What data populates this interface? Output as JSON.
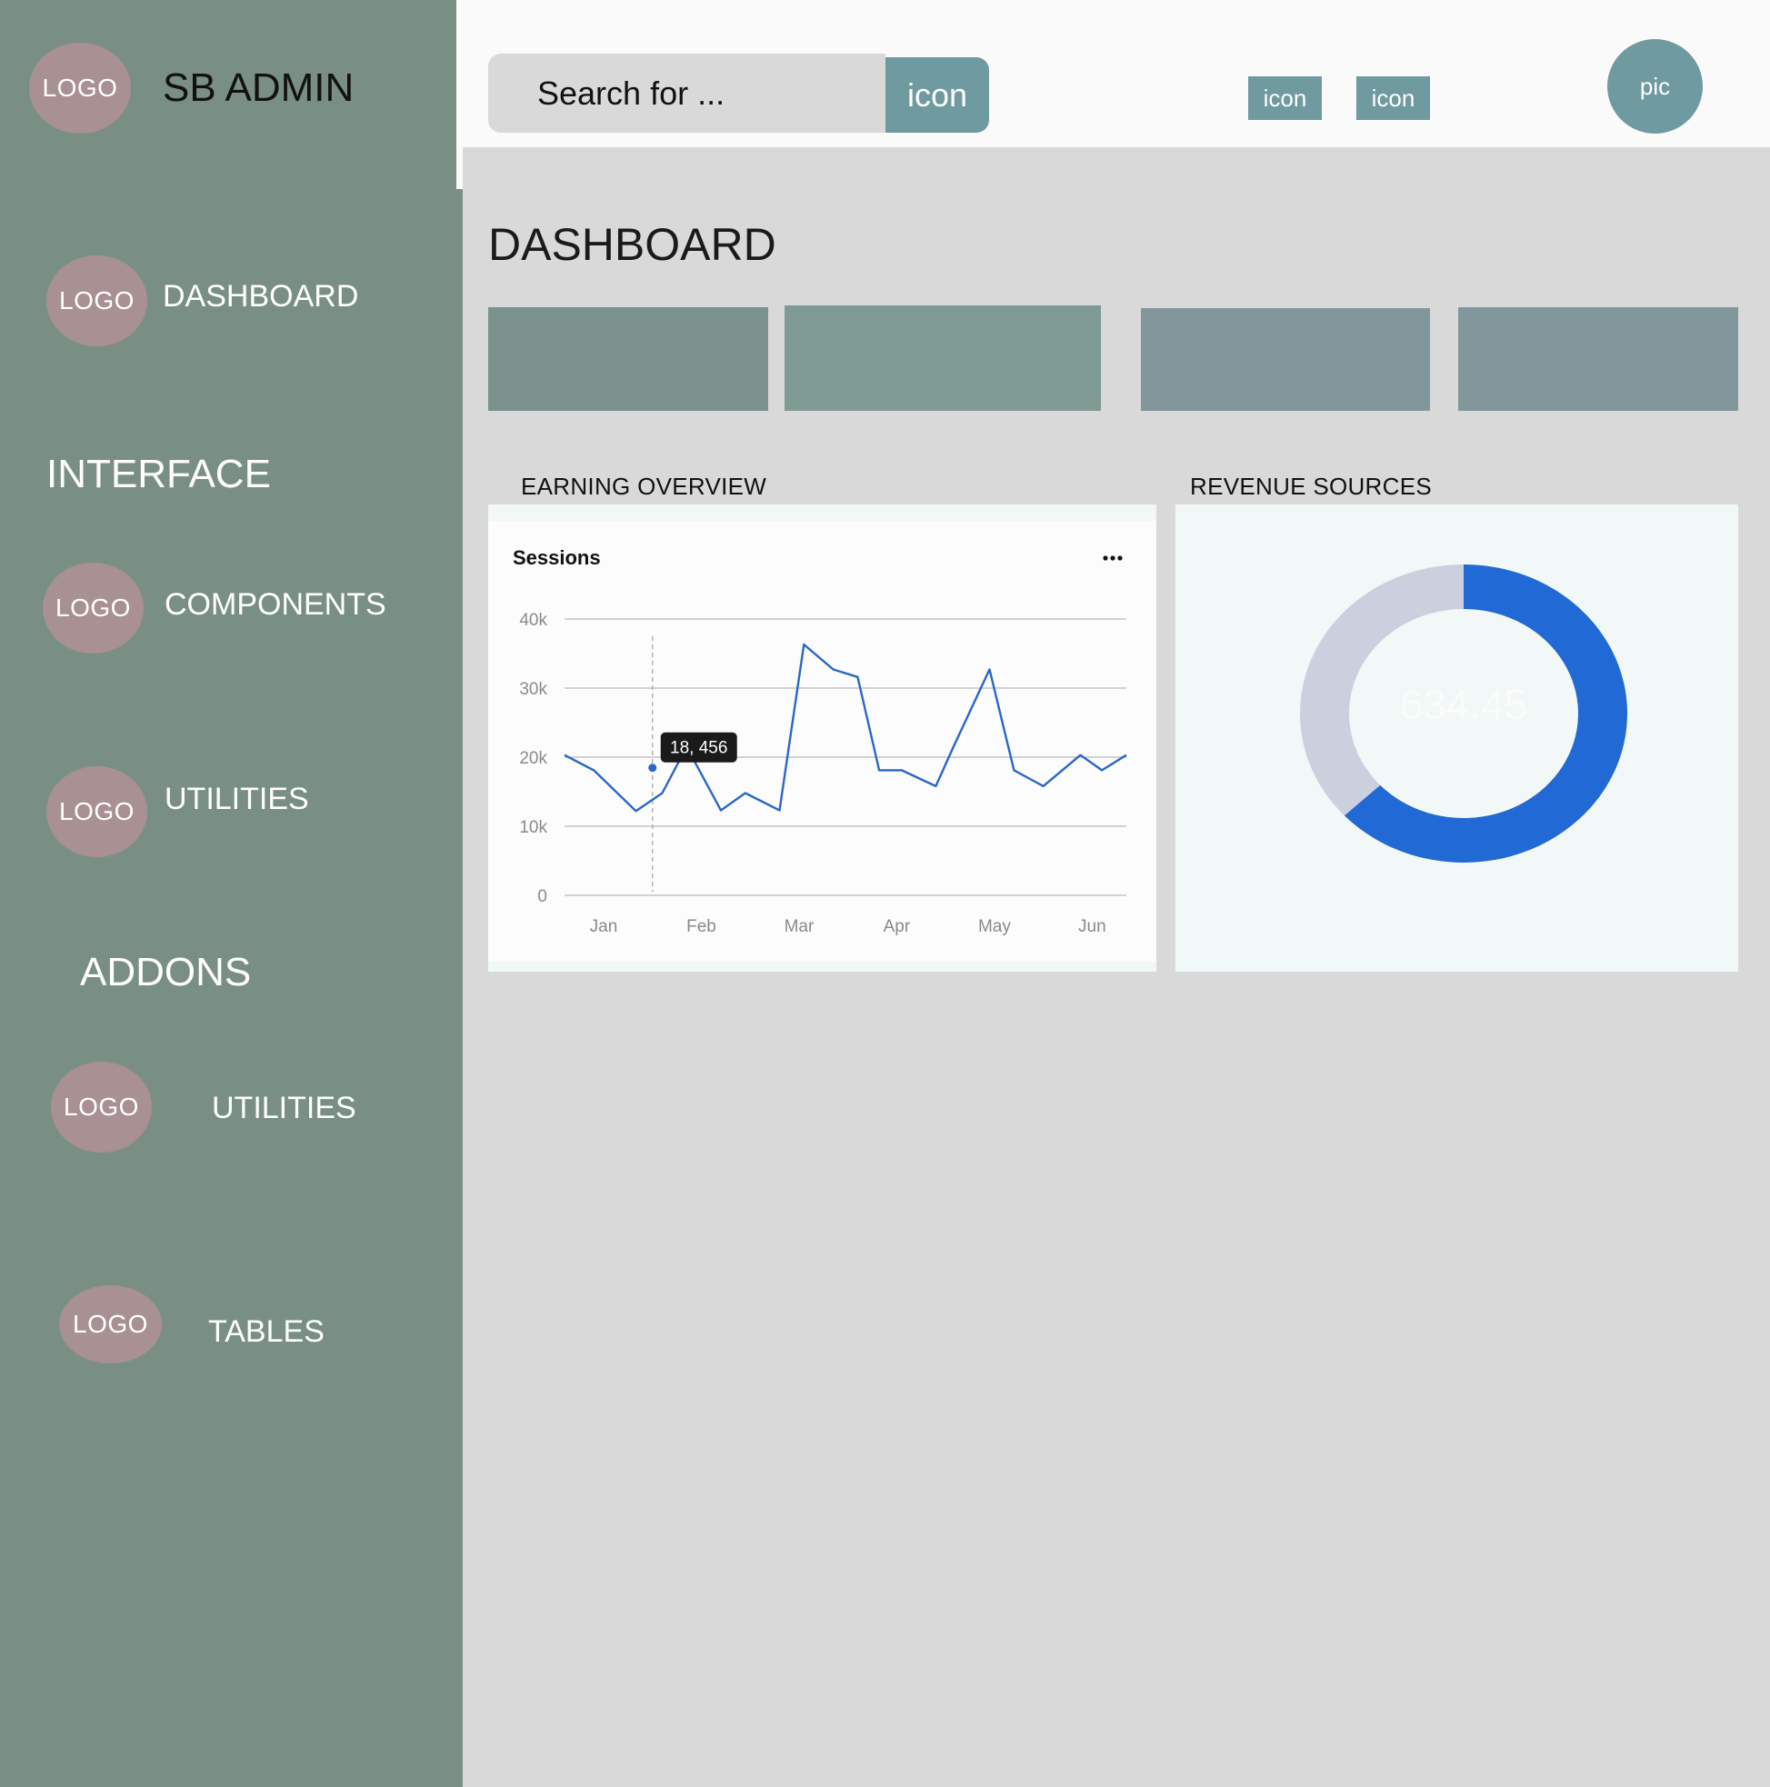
{
  "brand": {
    "logo": "LOGO",
    "name": "SB ADMIN"
  },
  "sidebar": {
    "items": [
      {
        "logo": "LOGO",
        "label": "DASHBOARD"
      },
      {
        "heading": "INTERFACE"
      },
      {
        "logo": "LOGO",
        "label": "COMPONENTS"
      },
      {
        "logo": "LOGO",
        "label": "UTILITIES"
      },
      {
        "heading": "ADDONS"
      },
      {
        "logo": "LOGO",
        "label": "UTILITIES"
      },
      {
        "logo": "LOGO",
        "label": "TABLES"
      }
    ]
  },
  "topbar": {
    "search_placeholder": "Search for ...",
    "search_button": "icon",
    "icon_1": "icon",
    "icon_2": "icon",
    "avatar": "pic"
  },
  "main": {
    "title": "DASHBOARD",
    "earning_title": "EARNING OVERVIEW",
    "revenue_title": "REVENUE SOURCES"
  },
  "colors": {
    "sidebar": "#7a8f84",
    "logo_circle": "#a89093",
    "accent": "#6f9aa0",
    "card_1": "#7a918c",
    "card_2": "#7f9b94",
    "card_3": "#81979b",
    "card_4": "#81979b",
    "line": "#2a67c7",
    "donut_primary": "#2169d4",
    "donut_secondary": "#ccd0de"
  },
  "chart_data": [
    {
      "type": "line",
      "title": "Sessions",
      "menu_icon": "more-horizontal-icon",
      "categories": [
        "Jan",
        "Feb",
        "Mar",
        "Apr",
        "May",
        "Jun"
      ],
      "yticks": [
        "40k",
        "30k",
        "20k",
        "10k",
        "0"
      ],
      "ylim": [
        0,
        40000
      ],
      "xlim": [
        0.6,
        6.35
      ],
      "grid": true,
      "series": [
        {
          "x": [
            0.6,
            0.9,
            1.33,
            1.6,
            1.85,
            2.2,
            2.45,
            2.8,
            3.05,
            3.35,
            3.6,
            3.82,
            4.05,
            4.4,
            4.58,
            4.95,
            5.2,
            5.5,
            5.88,
            6.1,
            6.35
          ],
          "values": [
            20300,
            18100,
            12200,
            14800,
            21500,
            12300,
            14800,
            12300,
            36300,
            32700,
            31600,
            18100,
            18100,
            15800,
            21500,
            32700,
            18100,
            15800,
            20300,
            18100,
            20300
          ]
        }
      ],
      "tooltip": {
        "x": 1.5,
        "value": 18456,
        "text": "18, 456"
      }
    },
    {
      "type": "pie",
      "values": [
        63,
        37
      ],
      "center_value": "634.45"
    }
  ]
}
